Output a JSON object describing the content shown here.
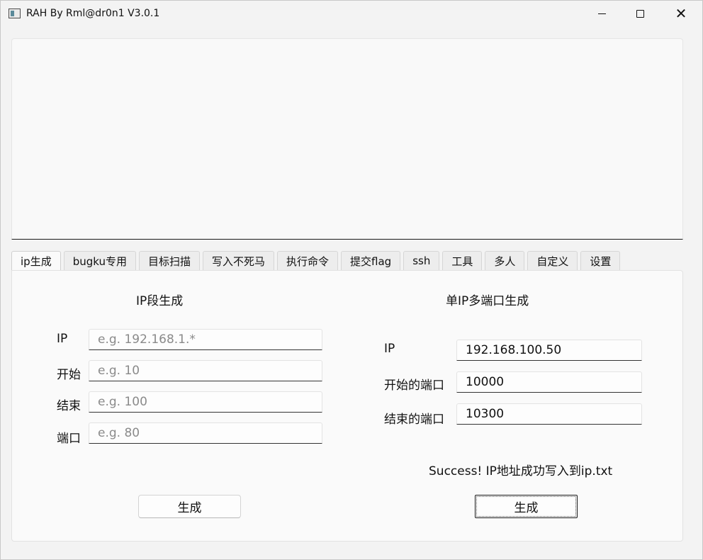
{
  "window": {
    "title": "RAH By Rml@dr0n1 V3.0.1",
    "icon": "app-window-icon",
    "controls": {
      "minimize": "minimize-icon",
      "maximize": "maximize-icon",
      "close": "close-icon"
    }
  },
  "tabs": [
    {
      "label": "ip生成",
      "active": true
    },
    {
      "label": "bugku专用"
    },
    {
      "label": "目标扫描"
    },
    {
      "label": "写入不死马"
    },
    {
      "label": "执行命令"
    },
    {
      "label": "提交flag"
    },
    {
      "label": "ssh"
    },
    {
      "label": "工具"
    },
    {
      "label": "多人"
    },
    {
      "label": "自定义"
    },
    {
      "label": "设置"
    }
  ],
  "left": {
    "title": "IP段生成",
    "fields": [
      {
        "label": "IP",
        "value": "",
        "placeholder": "e.g. 192.168.1.*"
      },
      {
        "label": "开始",
        "value": "",
        "placeholder": "e.g. 10"
      },
      {
        "label": "结束",
        "value": "",
        "placeholder": "e.g. 100"
      },
      {
        "label": "端口",
        "value": "",
        "placeholder": "e.g. 80"
      }
    ],
    "button": "生成"
  },
  "right": {
    "title": "单IP多端口生成",
    "fields": [
      {
        "label": "IP",
        "value": "192.168.100.50"
      },
      {
        "label": "开始的端口",
        "value": "10000"
      },
      {
        "label": "结束的端口",
        "value": "10300"
      }
    ],
    "status": "Success! IP地址成功写入到ip.txt",
    "button": "生成"
  }
}
